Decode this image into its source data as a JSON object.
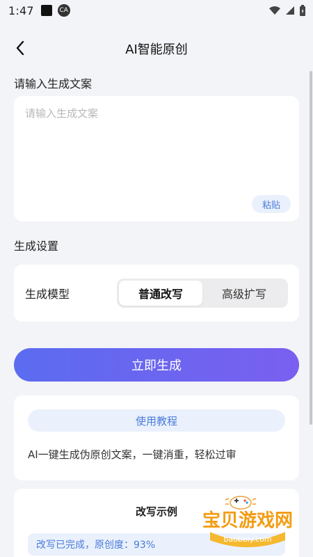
{
  "status_bar": {
    "time": "1:47",
    "app_icon_text": "CA"
  },
  "header": {
    "title": "AI智能原创"
  },
  "input_section": {
    "label": "请输入生成文案",
    "placeholder": "请输入生成文案",
    "value": "",
    "paste_label": "粘贴"
  },
  "settings_section": {
    "label": "生成设置",
    "model_label": "生成模型",
    "options": [
      "普通改写",
      "高级扩写"
    ],
    "selected": "普通改写"
  },
  "generate_button": {
    "label": "立即生成"
  },
  "tutorial": {
    "button_label": "使用教程",
    "description": "AI一键生成伪原创文案，一键消重，轻松过审"
  },
  "example": {
    "title": "改写示例",
    "status": "改写已完成，原创度：93%"
  },
  "watermark": {
    "text": "宝贝游戏网",
    "url": "baobeiy.com"
  },
  "colors": {
    "accent_blue": "#4a7bd8",
    "light_blue_bg": "#eaf1fd",
    "gradient_start": "#5b6cf0",
    "gradient_end": "#7a5ff0",
    "page_bg": "#f3f4f7"
  },
  "icons": {
    "back": "chevron-left-icon",
    "wifi": "wifi-icon",
    "signal": "cellular-signal-icon",
    "battery": "battery-icon"
  }
}
